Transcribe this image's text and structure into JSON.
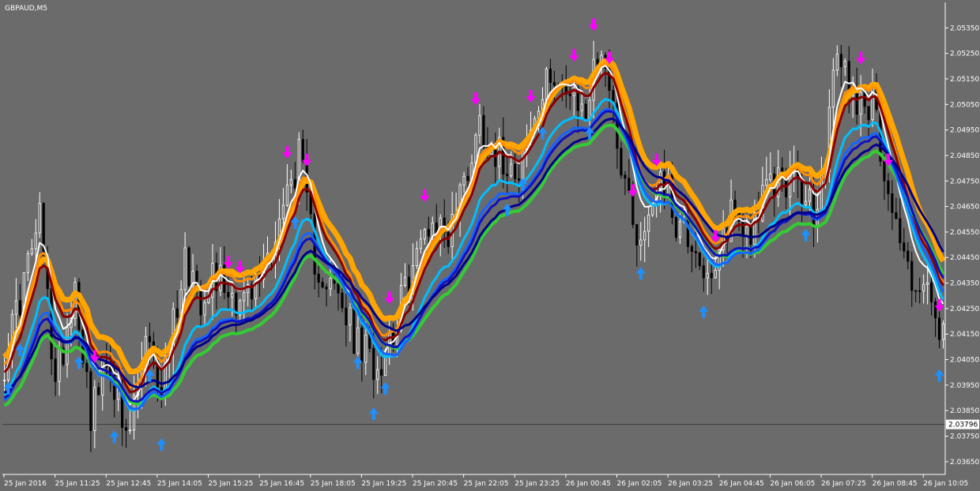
{
  "symbol": "GBPAUD,M5",
  "colors": {
    "background": "#6b6b6b",
    "bull_candle": "#ffffff",
    "bear_candle": "#000000",
    "axis": "#ffffff",
    "price_line": "#3c3c3c",
    "sell_arrow": "#ff00ff",
    "buy_arrow": "#1e90ff",
    "ma_orange": "#ffa500",
    "ma_dark_orange": "#ff8c00",
    "ma_red": "#8b0000",
    "ma_white": "#ffffff",
    "ma_green": "#32cd32",
    "ma_cyan": "#00bfff",
    "ma_blue": "#1010c0",
    "ma_mid_blue": "#1565ff",
    "ma_navy": "#00008b"
  },
  "chart_data": {
    "type": "candlestick",
    "title": "GBPAUD,M5",
    "ylim": [
      2.036,
      2.0545
    ],
    "y_ticks": [
      "2.05350",
      "2.05250",
      "2.05150",
      "2.05050",
      "2.04950",
      "2.04850",
      "2.04750",
      "2.04650",
      "2.04550",
      "2.04450",
      "2.04350",
      "2.04250",
      "2.04150",
      "2.04050",
      "2.03950",
      "2.03850",
      "2.03750",
      "2.03650"
    ],
    "current_price": "2.03796",
    "x_ticks": [
      "25 Jan 2016",
      "25 Jan 11:25",
      "25 Jan 12:45",
      "25 Jan 14:05",
      "25 Jan 15:25",
      "25 Jan 16:45",
      "25 Jan 18:05",
      "25 Jan 19:25",
      "25 Jan 20:45",
      "25 Jan 22:05",
      "25 Jan 23:25",
      "26 Jan 00:45",
      "26 Jan 02:05",
      "26 Jan 03:25",
      "26 Jan 04:45",
      "26 Jan 06:05",
      "26 Jan 07:25",
      "26 Jan 08:45",
      "26 Jan 10:05"
    ],
    "price_path_index": [
      0,
      9,
      13,
      18,
      22,
      27,
      31,
      36,
      40,
      46,
      50,
      53,
      59,
      63,
      68,
      75,
      79,
      86,
      90,
      95,
      99,
      104,
      108,
      113,
      117,
      121,
      126,
      131,
      135,
      140,
      144,
      148,
      152,
      158,
      162,
      167,
      171,
      176,
      180,
      185,
      189,
      194,
      198,
      203,
      207,
      212,
      216,
      221,
      226,
      230,
      235,
      238
    ],
    "price_path_value": [
      2.0405,
      2.046,
      2.0395,
      2.0435,
      2.0385,
      2.0405,
      2.037,
      2.041,
      2.0395,
      2.0445,
      2.043,
      2.044,
      2.043,
      2.043,
      2.045,
      2.0485,
      2.0445,
      2.0425,
      2.041,
      2.0403,
      2.0418,
      2.044,
      2.046,
      2.0455,
      2.0475,
      2.0498,
      2.0485,
      2.0482,
      2.0498,
      2.052,
      2.0505,
      2.0503,
      2.053,
      2.0475,
      2.045,
      2.048,
      2.046,
      2.045,
      2.043,
      2.0465,
      2.0455,
      2.047,
      2.0478,
      2.047,
      2.046,
      2.0525,
      2.051,
      2.0505,
      2.0465,
      2.044,
      2.043,
      2.0415
    ],
    "sell_arrow_price": [
      2.0468,
      2.0442,
      2.0428,
      2.0405,
      2.0452,
      2.0482,
      2.0425,
      2.044,
      2.047,
      2.0507,
      2.0522,
      2.0535,
      2.0506,
      2.0482,
      2.0482,
      2.0485,
      2.0522,
      2.0523
    ],
    "buy_arrow_price": [
      2.0395,
      2.0385,
      2.0376,
      2.0373,
      2.04,
      2.0405,
      2.04,
      2.0405,
      2.0395,
      2.041,
      2.0465,
      2.0475,
      2.0495,
      2.044,
      2.0425,
      2.0455,
      2.046,
      2.0495
    ]
  }
}
